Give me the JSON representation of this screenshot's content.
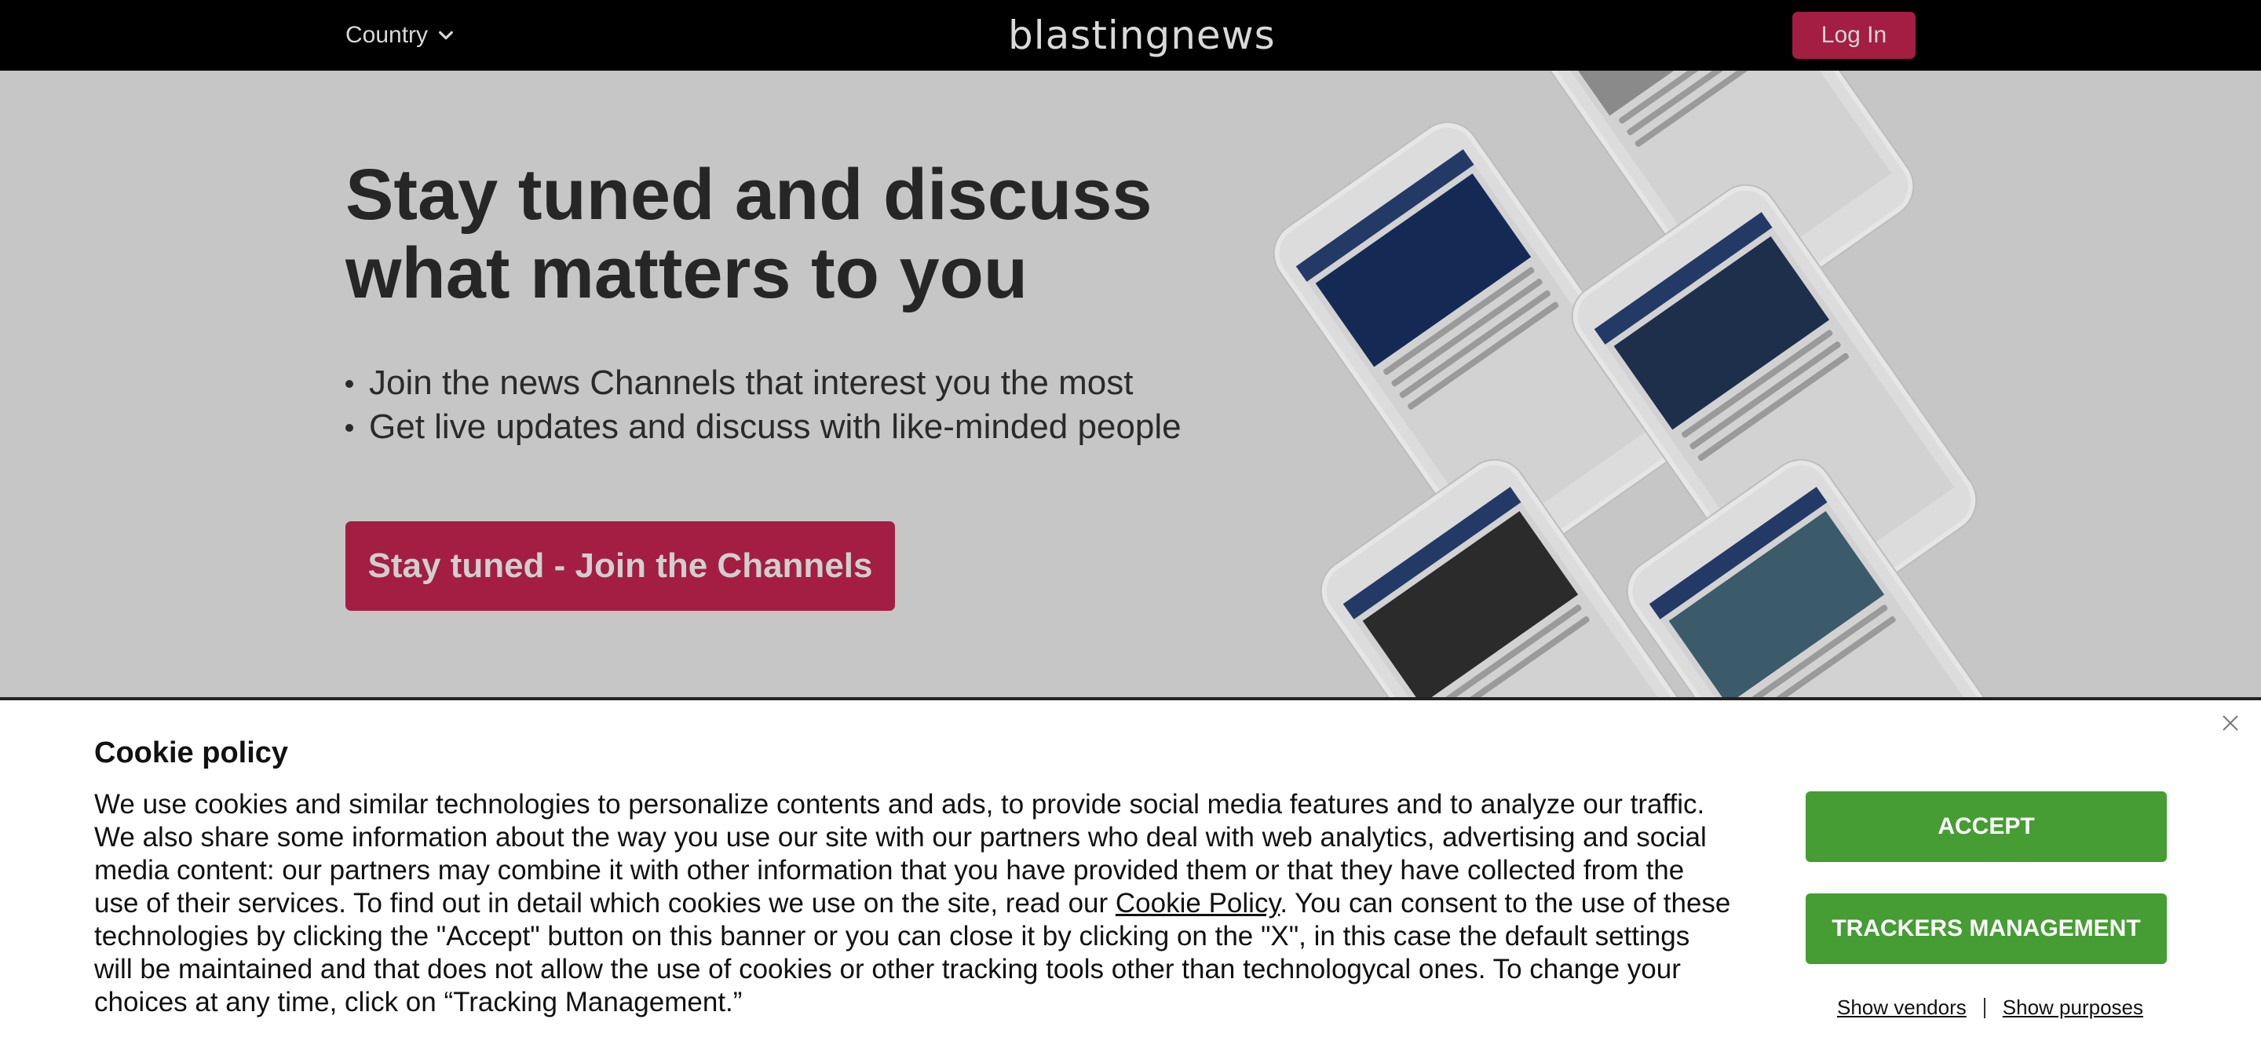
{
  "nav": {
    "country_label": "Country",
    "logo_text": "blastingnews",
    "login_label": "Log In"
  },
  "hero": {
    "title_line1": "Stay tuned and discuss",
    "title_line2": "what matters to you",
    "bullets": [
      "Join the news Channels that interest you the most",
      "Get live updates and discuss with like-minded people"
    ],
    "cta_label": "Stay tuned - Join the Channels"
  },
  "cookie": {
    "title": "Cookie policy",
    "text_before_link": "We use cookies and similar technologies to personalize contents and ads, to provide social media features and to analyze our traffic. We also share some information about the way you use our site with our partners who deal with web analytics, advertising and social media content: our partners may combine it with other information that you have provided them or that they have collected from the use of their services. To find out in detail which cookies we use on the site, read our ",
    "link_label": "Cookie Policy",
    "text_after_link": ". You can consent to the use of these technologies by clicking the \"Accept\" button on this banner or you can close it by clicking on the \"X\", in this case the default settings will be maintained and that does not allow the use of cookies or other tracking tools other than technologycal ones. To change your choices at any time, click on “Tracking Management.”",
    "accept_label": "ACCEPT",
    "trackers_label": "TRACKERS MANAGEMENT",
    "show_vendors_label": "Show vendors",
    "show_purposes_label": "Show purposes"
  },
  "colors": {
    "brand_red": "#a41d42",
    "accept_green": "#459d33",
    "nav_bg": "#000000"
  },
  "icons": {
    "country_chevron": "chevron-down-icon",
    "close": "close-icon"
  }
}
